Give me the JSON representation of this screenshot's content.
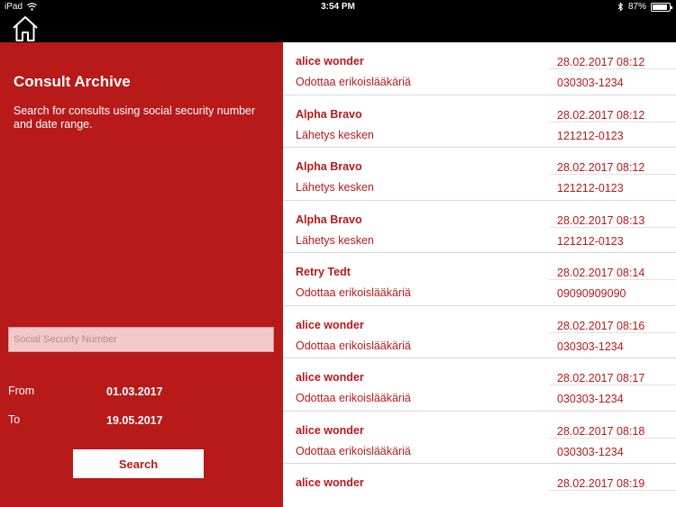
{
  "status_bar": {
    "device": "iPad",
    "time": "3:54 PM",
    "battery": "87%",
    "battery_level": 0.87
  },
  "sidebar": {
    "title": "Consult Archive",
    "description": "Search for consults using social security number and date range.",
    "ssn_placeholder": "Social Security Number",
    "from_label": "From",
    "from_value": "01.03.2017",
    "to_label": "To",
    "to_value": "19.05.2017",
    "search_label": "Search"
  },
  "consults": [
    {
      "name": "alice wonder",
      "status": "Odottaa erikoislääkäriä",
      "date": "28.02.2017 08:12",
      "ssn": "030303-1234"
    },
    {
      "name": "Alpha  Bravo",
      "status": "Lähetys kesken",
      "date": "28.02.2017 08:12",
      "ssn": "121212-0123"
    },
    {
      "name": "Alpha  Bravo",
      "status": "Lähetys kesken",
      "date": "28.02.2017 08:12",
      "ssn": "121212-0123"
    },
    {
      "name": "Alpha  Bravo",
      "status": "Lähetys kesken",
      "date": "28.02.2017 08:13",
      "ssn": "121212-0123"
    },
    {
      "name": "Retry Tedt",
      "status": "Odottaa erikoislääkäriä",
      "date": "28.02.2017 08:14",
      "ssn": "09090909090"
    },
    {
      "name": "alice wonder",
      "status": "Odottaa erikoislääkäriä",
      "date": "28.02.2017 08:16",
      "ssn": "030303-1234"
    },
    {
      "name": "alice wonder",
      "status": "Odottaa erikoislääkäriä",
      "date": "28.02.2017 08:17",
      "ssn": "030303-1234"
    },
    {
      "name": "alice wonder",
      "status": "Odottaa erikoislääkäriä",
      "date": "28.02.2017 08:18",
      "ssn": "030303-1234"
    },
    {
      "name": "alice wonder",
      "status": "",
      "date": "28.02.2017 08:19",
      "ssn": ""
    }
  ],
  "icons": {
    "home": "home-icon",
    "wifi": "wifi-icon",
    "bluetooth": "bluetooth-icon",
    "battery": "battery-icon"
  },
  "colors": {
    "accent": "#b81919",
    "status_bar": "#000000",
    "list_background": "#ffffff"
  }
}
